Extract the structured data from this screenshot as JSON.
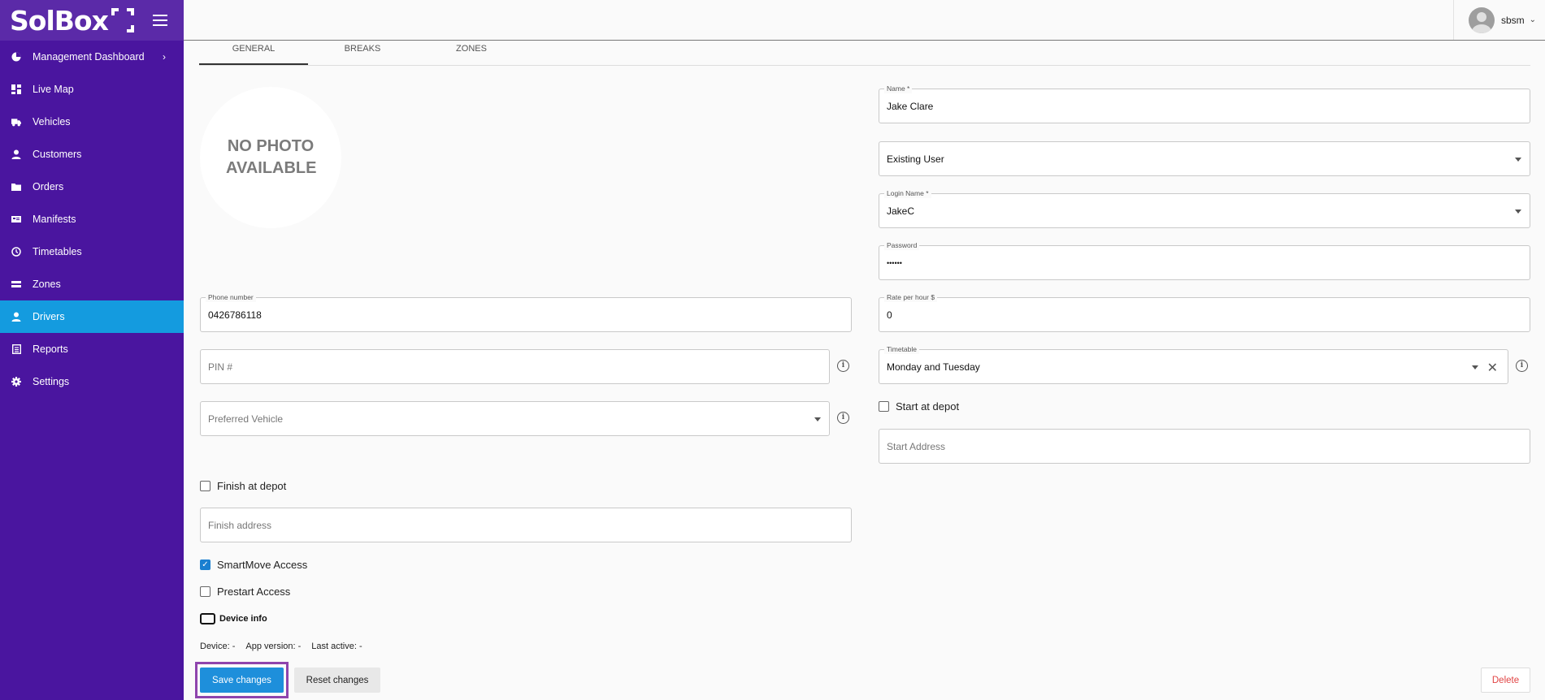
{
  "brand": {
    "logo_text": "SolBox"
  },
  "sidebar": {
    "items": [
      {
        "label": "Management Dashboard",
        "icon": "pie-chart-icon",
        "has_chevron": true
      },
      {
        "label": "Live Map",
        "icon": "dashboard-icon"
      },
      {
        "label": "Vehicles",
        "icon": "truck-icon"
      },
      {
        "label": "Customers",
        "icon": "person-icon"
      },
      {
        "label": "Orders",
        "icon": "folder-icon"
      },
      {
        "label": "Manifests",
        "icon": "manifest-icon"
      },
      {
        "label": "Timetables",
        "icon": "clock-icon"
      },
      {
        "label": "Zones",
        "icon": "zones-icon"
      },
      {
        "label": "Drivers",
        "icon": "person-icon",
        "active": true
      },
      {
        "label": "Reports",
        "icon": "report-icon"
      },
      {
        "label": "Settings",
        "icon": "gear-icon"
      }
    ],
    "chevron": "›"
  },
  "header": {
    "username": "sbsm",
    "caret": "⌄"
  },
  "tabs": [
    {
      "label": "GENERAL",
      "active": true
    },
    {
      "label": "BREAKS"
    },
    {
      "label": "ZONES"
    }
  ],
  "photo": {
    "text": "NO PHOTO AVAILABLE"
  },
  "form": {
    "name": {
      "label": "Name *",
      "value": "Jake Clare"
    },
    "user_type": {
      "value": "Existing User"
    },
    "login_name": {
      "label": "Login Name *",
      "value": "JakeC"
    },
    "password": {
      "label": "Password",
      "value": "••••••"
    },
    "phone": {
      "label": "Phone number",
      "value": "0426786118"
    },
    "rate": {
      "label": "Rate per hour $",
      "value": "0"
    },
    "pin": {
      "placeholder": "PIN #"
    },
    "timetable": {
      "label": "Timetable",
      "value": "Monday and Tuesday"
    },
    "preferred_vehicle": {
      "placeholder": "Preferred Vehicle"
    },
    "start_at_depot": {
      "label": "Start at depot",
      "checked": false
    },
    "start_address": {
      "placeholder": "Start Address"
    },
    "finish_at_depot": {
      "label": "Finish at depot",
      "checked": false
    },
    "finish_address": {
      "placeholder": "Finish address"
    },
    "smartmove_access": {
      "label": "SmartMove Access",
      "checked": true
    },
    "prestart_access": {
      "label": "Prestart Access",
      "checked": false
    },
    "device_info": {
      "label": "Device info"
    },
    "device": "Device: -",
    "app_version": "App version: -",
    "last_active": "Last active: -",
    "info_glyph": "i",
    "clear_glyph": "✕",
    "check_glyph": "✓"
  },
  "actions": {
    "save_label": "Save changes",
    "reset_label": "Reset changes",
    "delete_label": "Delete"
  },
  "colors": {
    "sidebar_bg": "#4a159f",
    "active_nav": "#149bdf",
    "primary_button": "#1e8fdb",
    "delete_text": "#e14444",
    "focus_outline": "#8e44ad"
  }
}
